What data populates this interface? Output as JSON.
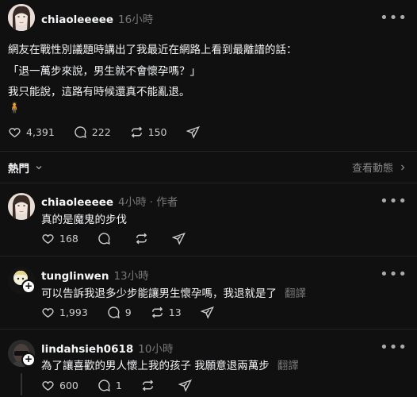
{
  "post": {
    "username": "chiaoleeeee",
    "time": "16小時",
    "lines": [
      "網友在戰性別議題時講出了我最近在網路上看到最離譜的話：",
      "「退一萬步來說，男生就不會懷孕嗎？」",
      "我只能說，這路有時候還真不能亂退。"
    ],
    "emoji": "🧍",
    "likes": "4,391",
    "comments": "222",
    "reposts": "150"
  },
  "sort": {
    "label": "熱門",
    "view_activity": "查看動態"
  },
  "replies": [
    {
      "username": "chiaoleeeee",
      "time": "4小時",
      "author_tag": "· 作者",
      "text": "真的是魔鬼的步伐",
      "likes": "168",
      "comments": "",
      "reposts": "",
      "translate": ""
    },
    {
      "username": "tunglinwen",
      "time": "13小時",
      "author_tag": "",
      "text": "可以告訴我退多少步能讓男生懷孕嗎，我退就是了",
      "likes": "1,993",
      "comments": "9",
      "reposts": "13",
      "translate": "翻譯"
    },
    {
      "username": "lindahsieh0618",
      "time": "10小時",
      "author_tag": "",
      "text": "為了讓喜歡的男人懷上我的孩子 我願意退兩萬步",
      "likes": "600",
      "comments": "1",
      "reposts": "",
      "translate": "翻譯"
    }
  ],
  "colors": {
    "background": "#101010",
    "text": "#f3f5f7",
    "muted": "#777777",
    "divider": "#262626"
  },
  "icons": [
    "heart-icon",
    "comment-icon",
    "repost-icon",
    "share-icon",
    "more-icon",
    "chevron-down-icon",
    "chevron-right-icon",
    "follow-plus-icon"
  ]
}
